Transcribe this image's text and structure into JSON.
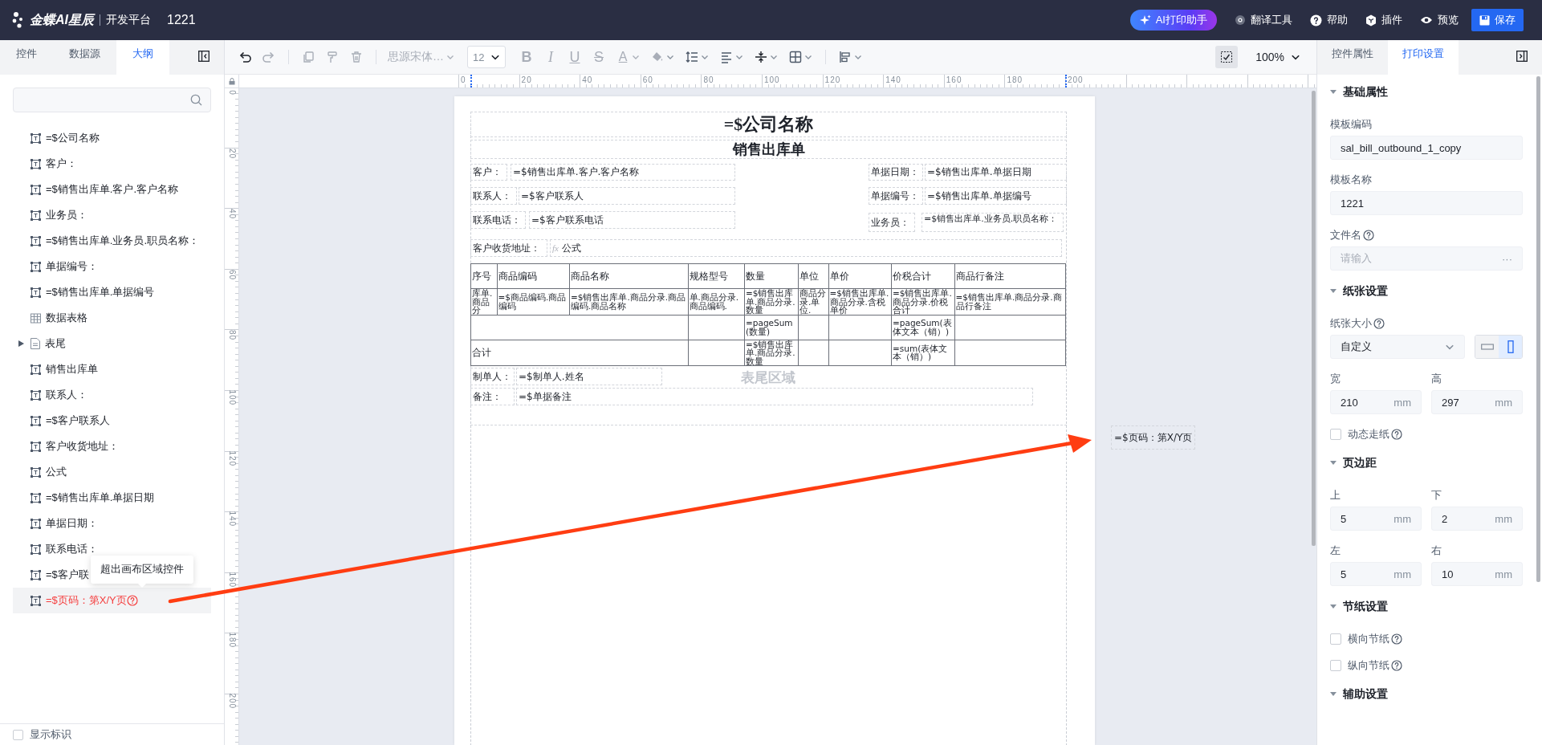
{
  "header": {
    "brand": "金蝶AI星辰",
    "platform": "开发平台",
    "doc_title": "1221",
    "actions": [
      {
        "kind": "ai",
        "label": "AI打印助手"
      },
      {
        "kind": "translate",
        "label": "翻译工具"
      },
      {
        "kind": "help",
        "label": "帮助"
      },
      {
        "kind": "plugin",
        "label": "插件"
      },
      {
        "kind": "preview",
        "label": "预览"
      },
      {
        "kind": "save",
        "label": "保存"
      }
    ]
  },
  "left_panel": {
    "tabs": [
      {
        "label": "控件",
        "selected": false
      },
      {
        "label": "数据源",
        "selected": false
      },
      {
        "label": "大纲",
        "selected": true
      }
    ],
    "outline": [
      {
        "kind": "text",
        "label": "=$公司名称",
        "selected": false,
        "warning": false
      },
      {
        "kind": "text",
        "label": "客户：",
        "selected": false,
        "warning": false
      },
      {
        "kind": "text",
        "label": "=$销售出库单.客户.客户名称",
        "selected": false,
        "warning": false
      },
      {
        "kind": "text",
        "label": "业务员：",
        "selected": false,
        "warning": false
      },
      {
        "kind": "text",
        "label": "=$销售出库单.业务员.职员名称：",
        "selected": false,
        "warning": false
      },
      {
        "kind": "text",
        "label": "单据编号：",
        "selected": false,
        "warning": false
      },
      {
        "kind": "text",
        "label": "=$销售出库单.单据编号",
        "selected": false,
        "warning": false
      },
      {
        "kind": "table",
        "label": "数据表格",
        "selected": false,
        "warning": false
      },
      {
        "kind": "group",
        "label": "表尾",
        "expanded": false,
        "selected": false,
        "warning": false
      },
      {
        "kind": "text",
        "label": "销售出库单",
        "selected": false,
        "warning": false
      },
      {
        "kind": "text",
        "label": "联系人：",
        "selected": false,
        "warning": false
      },
      {
        "kind": "text",
        "label": "=$客户联系人",
        "selected": false,
        "warning": false
      },
      {
        "kind": "text",
        "label": "客户收货地址：",
        "selected": false,
        "warning": false
      },
      {
        "kind": "text",
        "label": "公式",
        "selected": false,
        "warning": false
      },
      {
        "kind": "text",
        "label": "=$销售出库单.单据日期",
        "selected": false,
        "warning": false
      },
      {
        "kind": "text",
        "label": "单据日期：",
        "selected": false,
        "warning": false
      },
      {
        "kind": "text",
        "label": "联系电话：",
        "selected": false,
        "warning": false
      },
      {
        "kind": "text",
        "label": "=$客户联",
        "selected": false,
        "warning": false
      },
      {
        "kind": "text",
        "label": "=$页码：第X/Y页",
        "selected": true,
        "warning": true
      }
    ],
    "tooltip": "超出画布区域控件",
    "show_marks": {
      "label": "显示标识",
      "checked": false
    }
  },
  "toolbar": {
    "tools": [
      {
        "kind": "undo",
        "disabled": false
      },
      {
        "kind": "redo",
        "disabled": true
      },
      {
        "kind": "separator"
      },
      {
        "kind": "copy",
        "disabled": true
      },
      {
        "kind": "format-painter",
        "disabled": true
      },
      {
        "kind": "delete",
        "disabled": true
      },
      {
        "kind": "separator"
      },
      {
        "kind": "font",
        "value": "思源宋体…",
        "disabled": true
      },
      {
        "kind": "size",
        "value": "12",
        "disabled": false
      },
      {
        "kind": "bold",
        "label": "B",
        "disabled": true
      },
      {
        "kind": "italic",
        "label": "I",
        "disabled": true
      },
      {
        "kind": "underline",
        "label": "U",
        "disabled": true
      },
      {
        "kind": "strike",
        "label": "S",
        "disabled": true
      },
      {
        "kind": "text-color",
        "label": "A",
        "disabled": true
      },
      {
        "kind": "fill",
        "disabled": true
      },
      {
        "kind": "line-height",
        "disabled": false
      },
      {
        "kind": "align",
        "disabled": false
      },
      {
        "kind": "valign",
        "disabled": false
      },
      {
        "kind": "border",
        "disabled": false
      },
      {
        "kind": "separator"
      },
      {
        "kind": "arrange",
        "disabled": false
      }
    ],
    "fit_to_page": {
      "active": true
    },
    "zoom": "100%"
  },
  "rulers": {
    "horizontal": [
      "0",
      "20",
      "40",
      "60",
      "80",
      "100",
      "120",
      "140",
      "160",
      "180",
      "200"
    ],
    "vertical": [
      "0",
      "20",
      "40",
      "60",
      "80",
      "100",
      "120",
      "140",
      "160",
      "180",
      "200"
    ]
  },
  "document": {
    "title": "=$公司名称",
    "subtitle": "销售出库单",
    "fields": [
      {
        "kind": "text",
        "label": "客户：",
        "value": "=$销售出库单.客户.客户名称"
      },
      {
        "kind": "text",
        "label": "单据日期：",
        "value": "=$销售出库单.单据日期"
      },
      {
        "kind": "text",
        "label": "联系人：",
        "value": "=$客户联系人"
      },
      {
        "kind": "text",
        "label": "单据编号：",
        "value": "=$销售出库单.单据编号"
      },
      {
        "kind": "text",
        "label": "联系电话：",
        "value": "=$客户联系电话"
      },
      {
        "kind": "text",
        "label": "业务员：",
        "value": "=$销售出库单.业务员.职员名称："
      },
      {
        "kind": "formula",
        "label": "客户收货地址：",
        "prefix": "fx",
        "value": "公式"
      },
      {
        "kind": "text",
        "label": "制单人：",
        "value": "=$制单人.姓名"
      },
      {
        "kind": "text",
        "label": "备注：",
        "value": "=$单据备注"
      }
    ],
    "table": {
      "columns": [
        "序号",
        "商品编码",
        "商品名称",
        "规格型号",
        "数量",
        "单位",
        "单价",
        "价税合计",
        "商品行备注"
      ],
      "rows": [
        [
          "库单.商品分",
          "=$商品编码.商品编码",
          "=$销售出库单.商品分录.商品编码.商品名称",
          "单.商品分录.商品编码.",
          "=$销售出库单.商品分录.数量",
          "商品分录.单位.",
          "=$销售出库单.商品分录.含税单价",
          "=$销售出库单.商品分录.价税合计",
          "=$销售出库单.商品分录.商品行备注"
        ],
        [
          null,
          null,
          null,
          null,
          "=pageSum(数量)",
          null,
          null,
          "=pageSum(表体文本（销）)",
          null
        ],
        [
          "合计",
          null,
          null,
          null,
          "=$销售出库单.商品分录.数量",
          null,
          null,
          "=sum(表体文本（销）)",
          null
        ]
      ]
    },
    "footer_hint": "表尾区域",
    "offcanvas_field": "=$页码：第X/Y页"
  },
  "right_panel": {
    "tabs": [
      {
        "label": "控件属性",
        "selected": false
      },
      {
        "label": "打印设置",
        "selected": true
      }
    ],
    "sections": [
      {
        "title": "基础属性",
        "expanded": true,
        "items": [
          {
            "kind": "text",
            "label": "模板编码",
            "help": false,
            "value": "sal_bill_outbound_1_copy"
          },
          {
            "kind": "text",
            "label": "模板名称",
            "help": false,
            "value": "1221"
          },
          {
            "kind": "text",
            "label": "文件名",
            "help": true,
            "placeholder": "请输入",
            "more": "···"
          }
        ]
      },
      {
        "title": "纸张设置",
        "expanded": true,
        "items": [
          {
            "kind": "paper",
            "label": "纸张大小",
            "help": true,
            "value": "自定义",
            "orientations": [
              {
                "kind": "landscape",
                "selected": false
              },
              {
                "kind": "portrait",
                "selected": true
              }
            ]
          },
          {
            "kind": "pair",
            "fields": [
              {
                "label": "宽",
                "value": "210",
                "unit": "mm"
              },
              {
                "label": "高",
                "value": "297",
                "unit": "mm"
              }
            ]
          },
          {
            "kind": "checkbox",
            "label": "动态走纸",
            "help": true,
            "checked": false
          }
        ]
      },
      {
        "title": "页边距",
        "expanded": true,
        "items": [
          {
            "kind": "pair",
            "fields": [
              {
                "label": "上",
                "value": "5",
                "unit": "mm"
              },
              {
                "label": "下",
                "value": "2",
                "unit": "mm"
              }
            ]
          },
          {
            "kind": "pair",
            "fields": [
              {
                "label": "左",
                "value": "5",
                "unit": "mm"
              },
              {
                "label": "右",
                "value": "10",
                "unit": "mm"
              }
            ]
          }
        ]
      },
      {
        "title": "节纸设置",
        "expanded": true,
        "items": [
          {
            "kind": "checkbox",
            "label": "横向节纸",
            "help": true,
            "checked": false
          },
          {
            "kind": "checkbox",
            "label": "纵向节纸",
            "help": true,
            "checked": false
          }
        ]
      },
      {
        "title": "辅助设置",
        "expanded": true
      }
    ]
  },
  "annotation": {
    "kind": "arrow"
  }
}
